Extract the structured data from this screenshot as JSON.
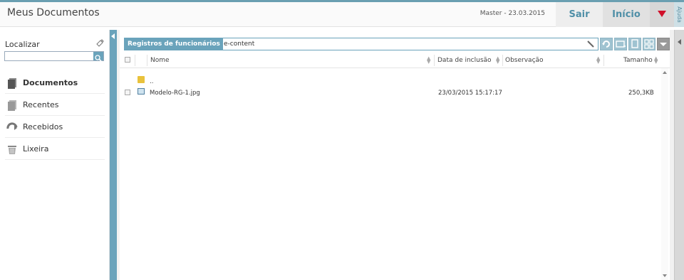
{
  "header": {
    "title": "Meus Documentos",
    "user_info": "Master  -  23.03.2015",
    "sair_label": "Sair",
    "inicio_label": "Início",
    "ajuda_label": "Ajuda"
  },
  "sidebar": {
    "search_label": "Localizar",
    "search_value": "",
    "items": [
      {
        "label": "Documentos",
        "icon": "documents-icon"
      },
      {
        "label": "Recentes",
        "icon": "recent-icon"
      },
      {
        "label": "Recebidos",
        "icon": "received-icon"
      },
      {
        "label": "Lixeira",
        "icon": "trash-icon"
      }
    ]
  },
  "main": {
    "path_tag": "Registros de funcionários",
    "path_sub": "e-content",
    "columns": [
      "Nome",
      "Data de inclusão",
      "Observação",
      "Tamanho"
    ],
    "rows": [
      {
        "name": "..",
        "date": "",
        "note": "",
        "size": "",
        "icon": "folder-icon"
      },
      {
        "name": "Modelo-RG-1.jpg",
        "date": "23/03/2015 15:17:17",
        "note": "",
        "size": "250,3KB",
        "icon": "image-file-icon"
      }
    ]
  },
  "colors": {
    "accent": "#6aa3bb",
    "button_text": "#4f8fa7",
    "menu_arrow": "#d0102a"
  }
}
